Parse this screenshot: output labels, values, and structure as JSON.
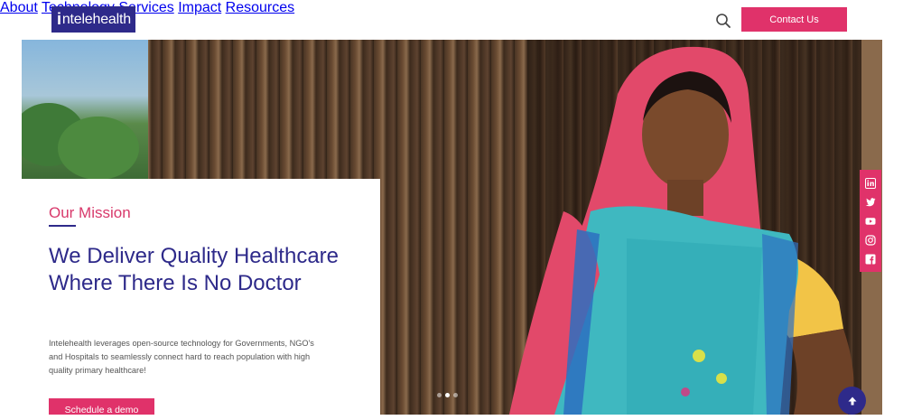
{
  "header": {
    "logo_text": "ntelehealth",
    "logo_prefix": "i",
    "nav": [
      {
        "label": "About"
      },
      {
        "label": "Technology"
      },
      {
        "label": "Services"
      },
      {
        "label": "Impact"
      },
      {
        "label": "Resources"
      }
    ],
    "contact_label": "Contact Us",
    "icons": {
      "search": "search-icon"
    }
  },
  "hero": {
    "eyebrow": "Our Mission",
    "title": "We Deliver Quality Healthcare Where There Is No Doctor",
    "description": "Intelehealth leverages open-source technology for Governments, NGO's and Hospitals to seamlessly connect hard to reach population with high quality primary healthcare!",
    "cta_label": "Schedule a demo",
    "slides": 3,
    "active_slide": 1
  },
  "social": [
    "linkedin-icon",
    "twitter-icon",
    "youtube-icon",
    "instagram-icon",
    "facebook-icon"
  ],
  "colors": {
    "brand_blue": "#2e2a8a",
    "accent_pink": "#e0326a"
  }
}
